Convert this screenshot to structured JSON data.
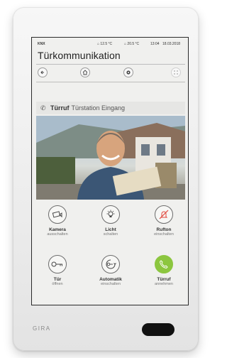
{
  "status_bar": {
    "system": "KNX",
    "temp_1": "12.5 °C",
    "temp_2": "20.5 °C",
    "time": "13:04",
    "date": "18.03.2018"
  },
  "page_title": "Türkommunikation",
  "nav": {
    "back_icon": "arrow-left-icon",
    "home_icon": "home-icon",
    "settings_icon": "gear-icon",
    "grid_icon": "grid-icon"
  },
  "call_header": {
    "type": "Türruf",
    "station": "Türstation Eingang"
  },
  "controls": [
    {
      "label": "Kamera",
      "sub": "ausschalten",
      "icon": "camera-icon"
    },
    {
      "label": "Licht",
      "sub": "schalten",
      "icon": "light-bulb-icon"
    },
    {
      "label": "Rufton",
      "sub": "einschalten",
      "icon": "bell-muted-icon"
    },
    {
      "label": "Tür",
      "sub": "öffnen",
      "icon": "key-icon"
    },
    {
      "label": "Automatik",
      "sub": "einschalten",
      "icon": "automatic-key-icon"
    },
    {
      "label": "Türruf",
      "sub": "annehmen",
      "icon": "phone-icon"
    }
  ],
  "colors": {
    "accept_green": "#8cc63f",
    "alert_red": "#e0453a",
    "screen_bg": "#f0f0ee"
  },
  "brand": "GIRA"
}
